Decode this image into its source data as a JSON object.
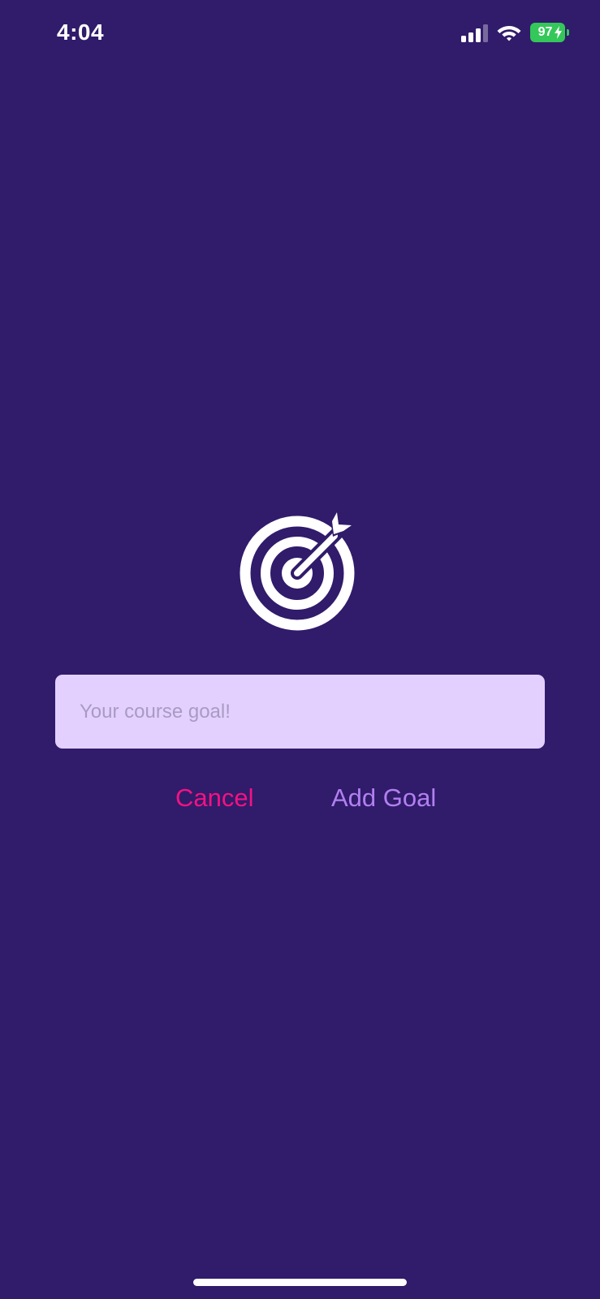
{
  "status_bar": {
    "time": "4:04",
    "battery_percent": "97",
    "battery_level": 0.97,
    "charging": true,
    "signal_bars": 3,
    "signal_max": 4,
    "icons": [
      "cellular-signal-icon",
      "wifi-icon",
      "battery-icon",
      "charging-bolt-icon"
    ]
  },
  "goal_form": {
    "icon": "target-with-arrow-icon",
    "input_value": "",
    "input_placeholder": "Your course goal!",
    "cancel_label": "Cancel",
    "add_label": "Add Goal"
  },
  "colors": {
    "background": "#311b6b",
    "input_background": "#e4d0ff",
    "placeholder": "#a89bc2",
    "cancel": "#f31282",
    "add": "#b180f0",
    "battery": "#34c759"
  }
}
